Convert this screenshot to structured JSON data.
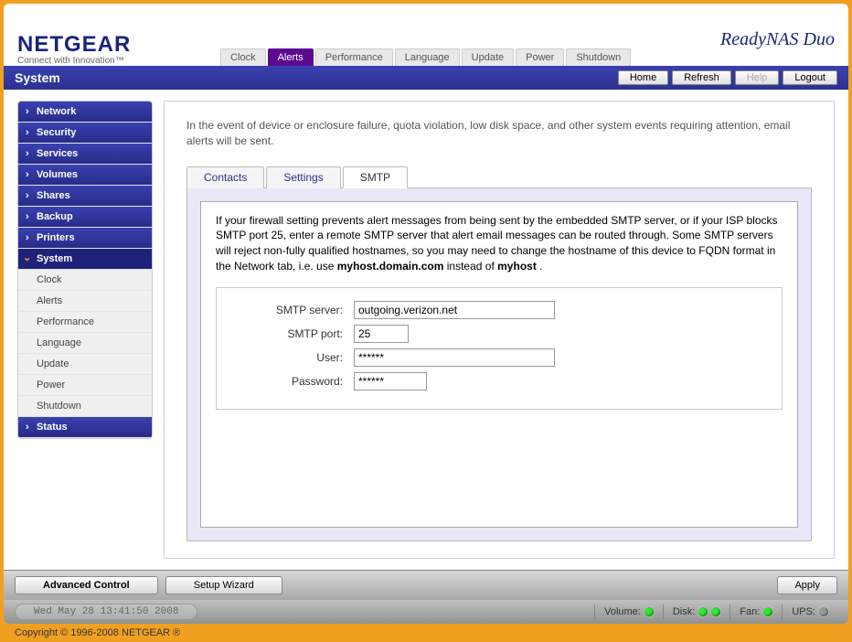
{
  "brand": {
    "name": "NETGEAR",
    "tagline": "Connect with Innovation™",
    "product": "ReadyNAS Duo"
  },
  "top_tabs": [
    "Clock",
    "Alerts",
    "Performance",
    "Language",
    "Update",
    "Power",
    "Shutdown"
  ],
  "top_tab_active": "Alerts",
  "title_bar": {
    "title": "System",
    "buttons": {
      "home": "Home",
      "refresh": "Refresh",
      "help": "Help",
      "logout": "Logout"
    }
  },
  "sidebar": {
    "main": [
      "Network",
      "Security",
      "Services",
      "Volumes",
      "Shares",
      "Backup",
      "Printers",
      "System"
    ],
    "active_main": "System",
    "sub": [
      "Clock",
      "Alerts",
      "Performance",
      "Language",
      "Update",
      "Power",
      "Shutdown"
    ],
    "footer": [
      "Status"
    ]
  },
  "content": {
    "intro": "In the event of device or enclosure failure, quota violation, low disk space, and other system events requiring attention, email alerts will be sent.",
    "subtabs": [
      "Contacts",
      "Settings",
      "SMTP"
    ],
    "subtab_active": "SMTP",
    "smtp": {
      "help_prefix": "If your firewall setting prevents alert messages from being sent by the embedded SMTP server, or if your ISP blocks SMTP port 25, enter a remote SMTP server that alert email messages can be routed through. Some SMTP servers will reject non-fully qualified hostnames, so you may need to change the hostname of this device to FQDN format in the Network tab, i.e. use ",
      "help_bold1": "myhost.domain.com",
      "help_mid": " instead of ",
      "help_bold2": "myhost",
      "help_suffix": " .",
      "labels": {
        "server": "SMTP server:",
        "port": "SMTP port:",
        "user": "User:",
        "password": "Password:"
      },
      "values": {
        "server": "outgoing.verizon.net",
        "port": "25",
        "user": "******",
        "password": "******"
      }
    }
  },
  "bottom": {
    "advanced": "Advanced Control",
    "wizard": "Setup Wizard",
    "apply": "Apply"
  },
  "status": {
    "datetime": "Wed May 28  13:41:50 2008",
    "volume": "Volume:",
    "disk": "Disk:",
    "fan": "Fan:",
    "ups": "UPS:"
  },
  "copyright": "Copyright © 1996-2008 NETGEAR ®"
}
